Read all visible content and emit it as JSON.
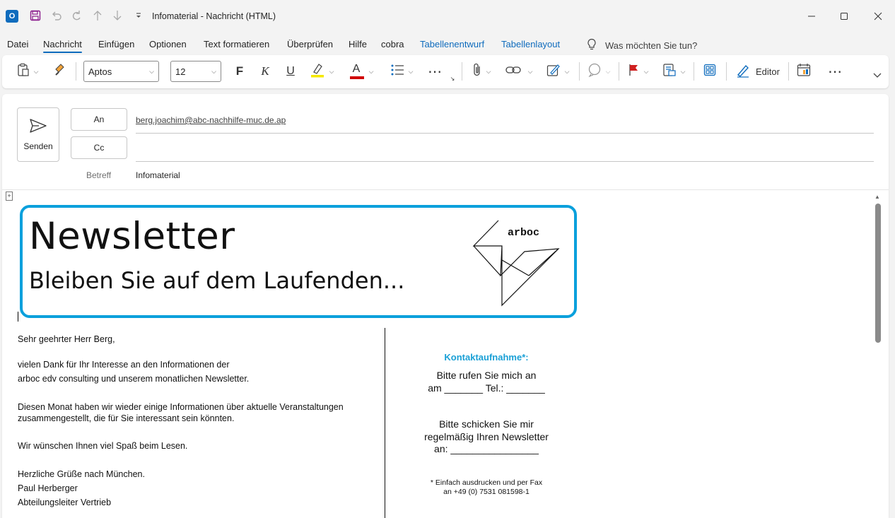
{
  "titlebar": {
    "title": "Infomaterial  -  Nachricht (HTML)"
  },
  "menu": {
    "tabs": [
      {
        "label": "Datei"
      },
      {
        "label": "Nachricht",
        "active": true
      },
      {
        "label": "Einfügen"
      },
      {
        "label": "Optionen"
      },
      {
        "label": "Text formatieren"
      },
      {
        "label": "Überprüfen"
      },
      {
        "label": "Hilfe"
      },
      {
        "label": "cobra"
      },
      {
        "label": "Tabellenentwurf",
        "contextual": true
      },
      {
        "label": "Tabellenlayout",
        "contextual": true
      }
    ],
    "tellme_placeholder": "Was möchten Sie tun?"
  },
  "ribbon": {
    "font_name": "Aptos",
    "font_size": "12",
    "bold_label": "F",
    "italic_label": "K",
    "underline_label": "U",
    "color_label": "A",
    "editor_label": "Editor",
    "highlight_color": "#f5e800",
    "font_color": "#d00000",
    "accent_color": "#0f6cbd",
    "flag_color": "#d02020"
  },
  "compose": {
    "send_label": "Senden",
    "to_label": "An",
    "cc_label": "Cc",
    "to_value": "berg.joachim@abc-nachhilfe-muc.de.ap",
    "cc_value": "",
    "subject_label": "Betreff",
    "subject_value": "Infomaterial"
  },
  "newsletter": {
    "title": "Newsletter",
    "subtitle": "Bleiben Sie auf dem Laufenden...",
    "logo_text": "arboc",
    "border_color": "#0aa0dc"
  },
  "letter": {
    "greeting": "Sehr geehrter Herr Berg,",
    "p1_line1": "vielen Dank für Ihr Interesse an den Informationen der",
    "p1_line2": "arboc edv consulting und unserem monatlichen Newsletter.",
    "p2_line1": "Diesen Monat haben wir wieder einige Informationen über aktuelle Veranstaltungen",
    "p2_line2": "zusammengestellt, die für Sie interessant sein könnten.",
    "p3": "Wir wünschen Ihnen viel Spaß beim Lesen.",
    "closing": "Herzliche Grüße nach München.",
    "sender_name": "Paul Herberger",
    "sender_title": "Abteilungsleiter Vertrieb"
  },
  "contact": {
    "heading": "Kontaktaufnahme*:",
    "call_line1": "Bitte rufen Sie mich an",
    "call_line2": "am _______ Tel.: _______",
    "send_line1": "Bitte schicken Sie mir",
    "send_line2": "regelmäßig Ihren Newsletter",
    "send_line3": "an: ________________",
    "note_line1": "* Einfach ausdrucken und  per Fax",
    "note_line2": "an +49 (0) 7531 081598-1",
    "heading_color": "#1aa0d6"
  }
}
